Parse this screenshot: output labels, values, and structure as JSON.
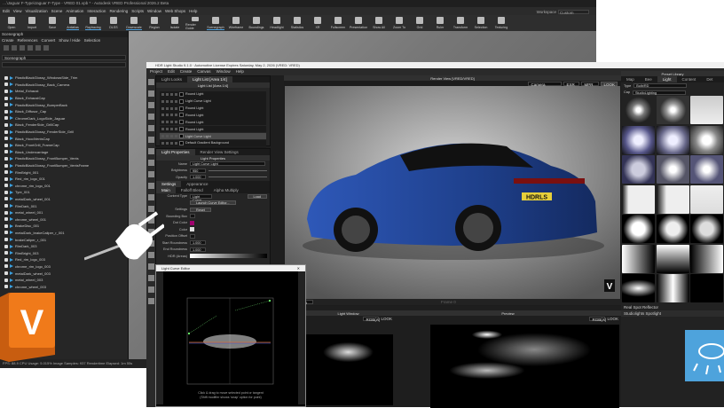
{
  "vred": {
    "title": "…\\Jaguar F-Type\\Jaguar F-Type - VRED 01.vpb * - Autodesk VRED Professional 2026.2 Beta",
    "menu": [
      "Edit",
      "View",
      "Visualization",
      "Scene",
      "Animation",
      "Interaction",
      "Rendering",
      "Scripts",
      "Window",
      "Web Shops",
      "Help"
    ],
    "toolbar": [
      {
        "label": "Open"
      },
      {
        "label": "Import"
      },
      {
        "label": "Save"
      },
      {
        "label": "Antialias",
        "active": true
      },
      {
        "label": "Raytracing",
        "active": true
      },
      {
        "label": "DLSS"
      },
      {
        "label": "Downscale",
        "active": true
      },
      {
        "label": "Region"
      },
      {
        "label": "Isolate"
      },
      {
        "label": "Render Guide"
      },
      {
        "label": "Scenegraph",
        "active": true
      },
      {
        "label": "Wireframe"
      },
      {
        "label": "Boundings"
      },
      {
        "label": "Headlight"
      },
      {
        "label": "Statistics"
      },
      {
        "label": "XR"
      },
      {
        "label": "Fullscreen"
      },
      {
        "label": "Presentation"
      },
      {
        "label": "Show All"
      },
      {
        "label": "Zoom To"
      },
      {
        "label": "Grid"
      },
      {
        "label": "Ruler"
      },
      {
        "label": "Transform"
      },
      {
        "label": "Selection"
      },
      {
        "label": "Texturing"
      }
    ],
    "workspace_label": "Workspace",
    "workspace_value": "Custom",
    "scenegraph": {
      "title": "Scenegraph",
      "menu": [
        "Create",
        "References",
        "Convert",
        "Show / Hide",
        "Selection"
      ],
      "dropdown": "Scenegraph",
      "items": [
        "PlasticBlackGlossy_WindowsSide_Trim",
        "PlasticBlackGlossy_Back_Camera",
        "Metal_Exhaust",
        "Black_ExhaustCap",
        "PlasticBlackGlossy_BumperBack",
        "Black_Diffusor_Cap",
        "ChromeDark_LogoSide_Jaguar",
        "Black_FenderSide_GrillCap",
        "PlasticBlackGlossy_FenderSide_Grill",
        "Black_HoodVentsCap",
        "Black_FrontGrill_FrameCap",
        "Black_Undercarriage",
        "PlasticBlackGlossy_FrontBumper_Vents",
        "PlasticBlackGlossy_FrontBumper_VentsFrame",
        "RimBright_001",
        "Red_rim_logo_001",
        "chrome_rim_logo_001",
        "Tyre_001",
        "metalDark_wheel_001",
        "RimDark_001",
        "metal_wheel_001",
        "chrome_wheel_001",
        "BrakeDisc_001",
        "metalDark_brakeCaliper_r_001",
        "brakeCaliper_r_001",
        "RimDark_003",
        "RimBright_003",
        "Red_rim_logo_003",
        "chrome_rim_logo_003",
        "metalDark_wheel_003",
        "metal_wheel_003",
        "chrome_wheel_003"
      ]
    },
    "status": "FPS: 88.9  CPU Usage: 5.015%  Image Samples: 937  Rendertime Elapsed: 1m 55s"
  },
  "hdrls": {
    "title": "HDR Light Studio 9.1.0 · Automotive License Expires Saturday, May 2, 2026 (VRED: VRED)",
    "menu": [
      "Project",
      "Edit",
      "Create",
      "Canvas",
      "Window",
      "Help"
    ],
    "light_list": {
      "tabs": [
        "Light Looks",
        "Light List [Area 1/4]"
      ],
      "title": "Light List [Area 1/4]",
      "lights": [
        {
          "name": "Round Light"
        },
        {
          "name": "Light Curve Light"
        },
        {
          "name": "Round Light"
        },
        {
          "name": "Round Light"
        },
        {
          "name": "Round Light"
        },
        {
          "name": "Round Light"
        },
        {
          "name": "Light Curve Light",
          "selected": true
        },
        {
          "name": "Default Gradient Background"
        },
        {
          "name": "Default Gradient Background"
        }
      ]
    },
    "properties": {
      "tabs": [
        "Light Properties",
        "Render View Settings"
      ],
      "title": "Light Properties",
      "name_label": "Name",
      "name": "Light Curve Light",
      "brightness_label": "Brightness",
      "brightness": "950",
      "opacity_label": "Opacity",
      "opacity": "1.000",
      "subtabs": [
        "Settings",
        "Appearance"
      ],
      "subsubtabs": [
        "Main",
        "Falloff Blend",
        "Alpha Multiply"
      ],
      "content_type_label": "Content Type",
      "content_type": "Light Curve",
      "load_label": "Load",
      "editor_button": "Launch Curve Editor...",
      "settings_label": "Settings",
      "reset_label": "Reset",
      "bounding_box_label": "Bounding Box",
      "dot_color_label": "Dot Color",
      "dot_color": "#a0006e",
      "color_label": "Color",
      "position_offset_label": "Position Offset",
      "start_roundness_label": "Start Roundness",
      "start_roundness": "1.000",
      "end_roundness_label": "End Roundness",
      "end_roundness": "1.000",
      "hdr_label": "HDR (Areas)"
    },
    "render_view": {
      "title": "Render View [VRED/VRED]",
      "camera": "Camera",
      "plate": "EXR Video",
      "mode": "MPR",
      "look_label": "LOOK",
      "plate_text": "HDRLS",
      "bottom_select": "Reflection (A)",
      "frame_label": "Frame 0"
    },
    "presets": {
      "title": "Preset Library",
      "tabs": [
        "Map",
        "Bee",
        "Light",
        "Content",
        "Det"
      ],
      "type_label": "Type",
      "type": "Bulb/RD",
      "cap_label": "Cap",
      "cap": "StudioLighting",
      "footer1": "Real Spot Reflector",
      "footer2": "Studiolights Spotlight"
    },
    "curve_editor": {
      "title": "Light Curve Editor",
      "hint1": "Click & drag to move selected point or tangent",
      "hint2": "(Shift modifier shows 'snap' option for point)"
    },
    "light_view": {
      "title": "Light Window",
      "mode": "RGB(A)",
      "look_label": "LOOK"
    },
    "preview": {
      "title": "Preview",
      "mode": "RGB(A)",
      "look_label": "LOOK"
    }
  },
  "colors": {
    "accent": "#4aa0e0",
    "vred_logo": "#f07a1a",
    "hdr_logo": "#4ea3dc",
    "car": "#1e3f8a"
  }
}
